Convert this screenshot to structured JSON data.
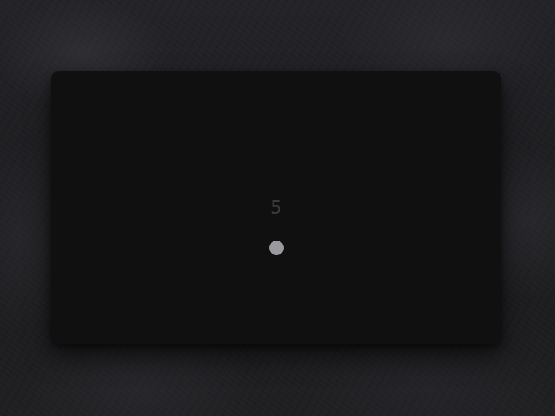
{
  "screen": {
    "counter_value": "5"
  },
  "colors": {
    "panel_background": "#111010",
    "counter_text": "#3a3a3c",
    "dot": "#9a999f",
    "desktop_background": "#1e1e21"
  },
  "icons": {
    "dot": "filled-circle-icon"
  }
}
